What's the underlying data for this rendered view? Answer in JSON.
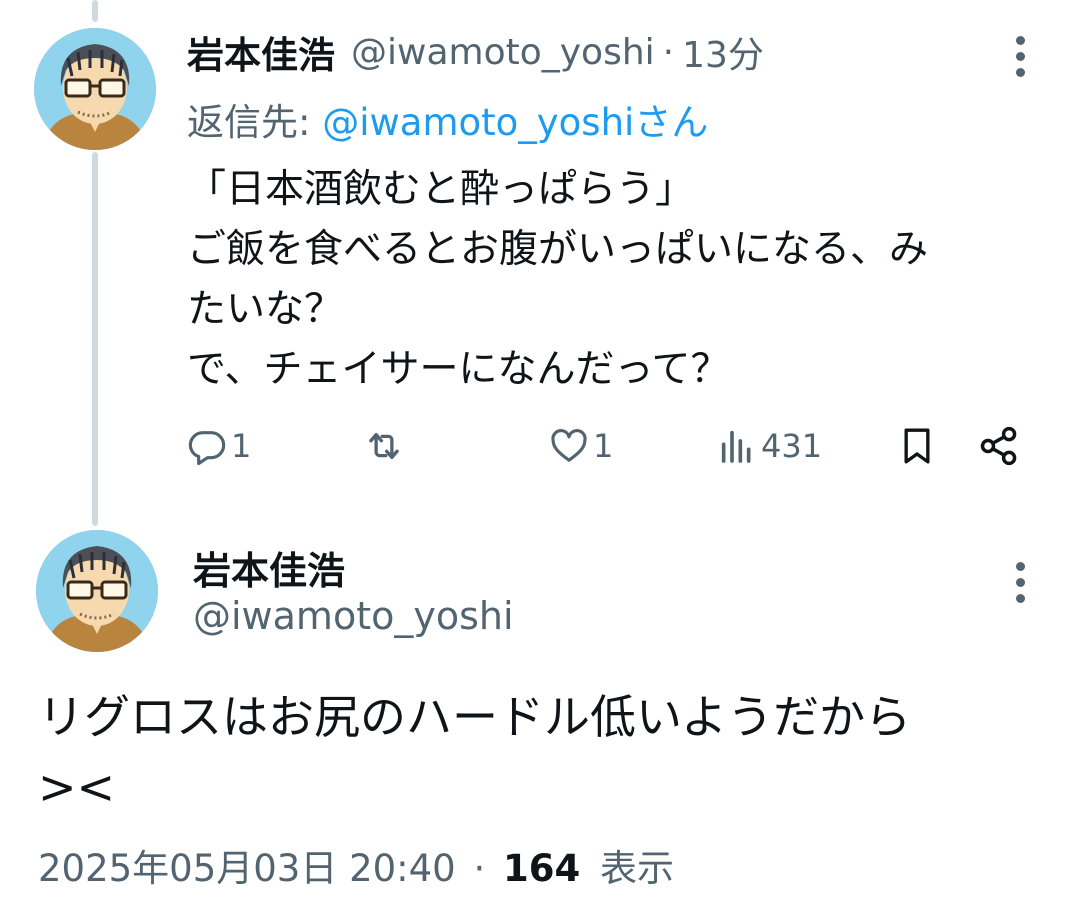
{
  "tweet1": {
    "name": "岩本佳浩",
    "handle": "@iwamoto_yoshi",
    "separator": "·",
    "time": "13分",
    "reply_prefix": "返信先: ",
    "reply_handle": "@iwamoto_yoshi",
    "reply_suffix": "さん",
    "lines": [
      "「日本酒飲むと酔っぱらう」",
      "ご飯を食べるとお腹がいっぱいになる、み",
      "たいな？",
      "で、チェイサーになんだって？"
    ],
    "actions": {
      "reply_count": "1",
      "retweet_count": "",
      "like_count": "1",
      "views_count": "431"
    }
  },
  "tweet2": {
    "name": "岩本佳浩",
    "handle": "@iwamoto_yoshi",
    "lines": [
      "リグロスはお尻のハードル低いようだから",
      "><"
    ],
    "meta": {
      "timestamp": "2025年05月03日 20:40",
      "separator": "·",
      "views_count": "164",
      "views_label": "表示"
    }
  },
  "icons": {
    "reply": "reply-icon",
    "retweet": "retweet-icon",
    "like": "heart-icon",
    "views": "views-icon",
    "bookmark": "bookmark-icon",
    "share": "share-icon",
    "more": "more-vertical-icon"
  },
  "colors": {
    "text_primary": "#0f1419",
    "text_secondary": "#536471",
    "link": "#1d9bf0",
    "thread_line": "#cfd9de"
  }
}
